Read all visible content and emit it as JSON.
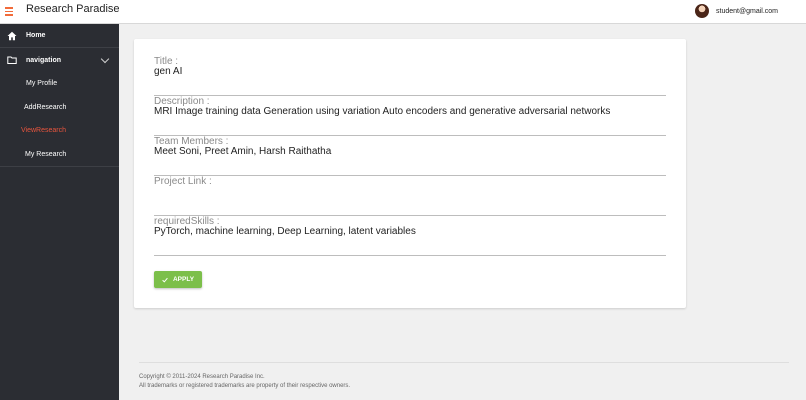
{
  "header": {
    "title": "Research Paradise",
    "user_email": "student@gmail.com"
  },
  "sidebar": {
    "home_label": "Home",
    "navigation_label": "navigation",
    "items": [
      {
        "label": "My Profile"
      },
      {
        "label": "AddResearch"
      },
      {
        "label": "ViewResearch",
        "active": true
      },
      {
        "label": "My Research"
      }
    ]
  },
  "research": {
    "title_label": "Title :",
    "title_value": "gen AI",
    "description_label": "Description :",
    "description_value": "MRI Image training data Generation using variation Auto encoders and generative adversarial networks",
    "team_label": "Team Members :",
    "team_value": "Meet Soni, Preet Amin, Harsh Raithatha",
    "link_label": "Project Link :",
    "link_value": "",
    "skills_label": "requiredSkills :",
    "skills_value": "PyTorch, machine learning, Deep Learning, latent variables",
    "apply_label": "APPLY"
  },
  "footer": {
    "copyright": "Copyright © 2011-2024 Research Paradise Inc.",
    "trademark": "All trademarks or registered trademarks are property of their respective owners."
  },
  "colors": {
    "sidebar_bg": "#2b2d33",
    "active_item": "#e8553e",
    "apply_button": "#7cbf4a",
    "menu_icon": "#f26b3a"
  }
}
